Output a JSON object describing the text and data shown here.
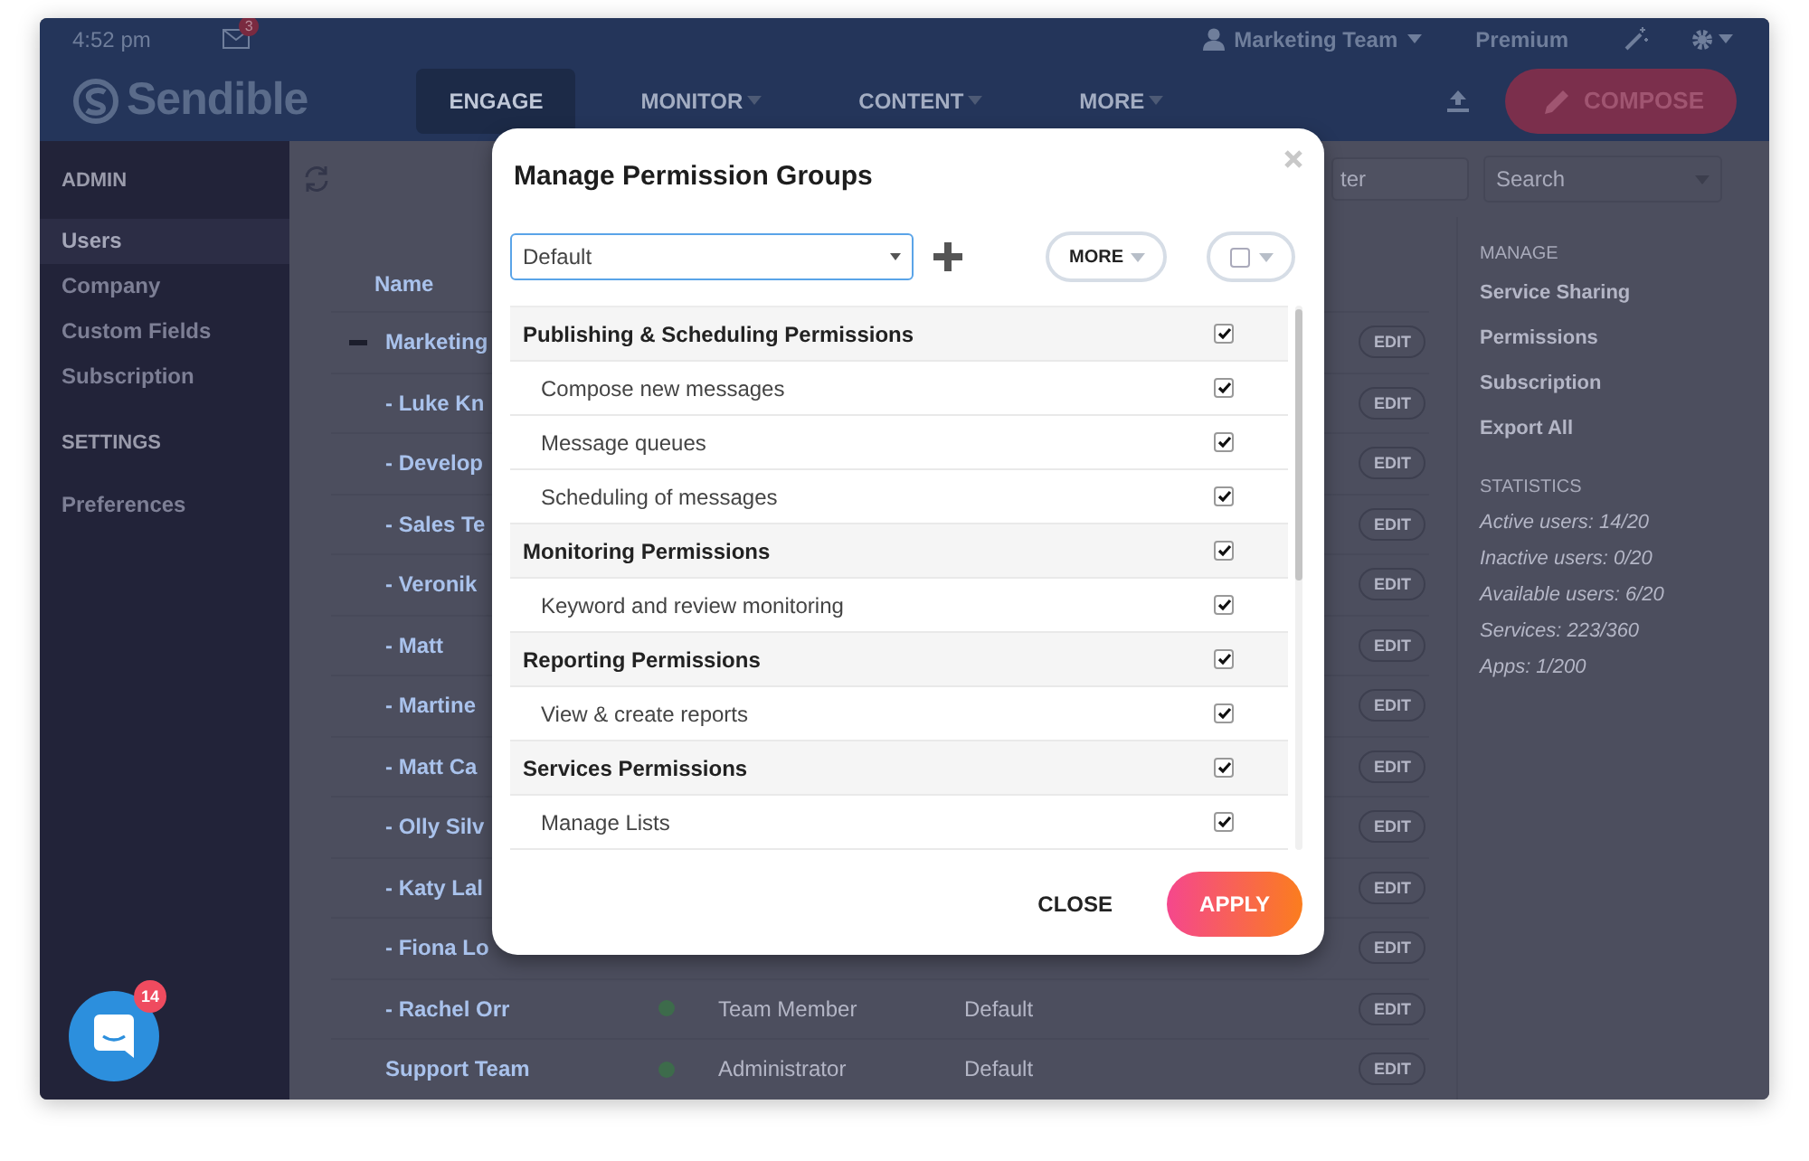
{
  "top_bar": {
    "time": "4:52 pm",
    "mail_badge": "3",
    "account": "Marketing Team",
    "plan": "Premium"
  },
  "nav_bar": {
    "logo": "Sendible",
    "items": [
      {
        "label": "ENGAGE",
        "selected": true,
        "dropdown": false
      },
      {
        "label": "MONITOR",
        "selected": false,
        "dropdown": true
      },
      {
        "label": "CONTENT",
        "selected": false,
        "dropdown": true
      },
      {
        "label": "MORE",
        "selected": false,
        "dropdown": true
      }
    ],
    "compose_button": "COMPOSE"
  },
  "sidebar": {
    "sections": [
      {
        "heading": "ADMIN",
        "items": [
          {
            "label": "Users",
            "selected": true
          },
          {
            "label": "Company",
            "selected": false
          },
          {
            "label": "Custom Fields",
            "selected": false
          },
          {
            "label": "Subscription",
            "selected": false
          }
        ]
      },
      {
        "heading": "SETTINGS",
        "items": [
          {
            "label": "Preferences",
            "selected": false
          }
        ]
      }
    ]
  },
  "toolbar": {
    "filter": {
      "placeholder": "ter"
    },
    "search": {
      "placeholder": "Search"
    }
  },
  "table": {
    "columns": [
      "Name"
    ],
    "rows": [
      {
        "name": "Marketing",
        "expanded": true,
        "action": "EDIT"
      },
      {
        "name": "- Luke Kn",
        "action": "EDIT"
      },
      {
        "name": "- Develop",
        "action": "EDIT"
      },
      {
        "name": "- Sales Te",
        "action": "EDIT"
      },
      {
        "name": "- Veronik",
        "action": "EDIT"
      },
      {
        "name": "- Matt",
        "action": "EDIT"
      },
      {
        "name": "- Martine",
        "action": "EDIT"
      },
      {
        "name": "- Matt Ca",
        "action": "EDIT"
      },
      {
        "name": "- Olly Silv",
        "action": "EDIT"
      },
      {
        "name": "- Katy Lal",
        "action": "EDIT"
      },
      {
        "name": "- Fiona Lo",
        "action": "EDIT"
      },
      {
        "name": "- Rachel Orr",
        "color": "#3d6b4b",
        "role": "Team Member",
        "group": "Default",
        "action": "EDIT"
      },
      {
        "name": "Support Team",
        "color": "#3d6b4b",
        "role": "Administrator",
        "group": "Default",
        "action": "EDIT"
      }
    ]
  },
  "manage_panel": {
    "heading": "MANAGE",
    "links": [
      "Service Sharing",
      "Permissions",
      "Subscription",
      "Export All"
    ],
    "statistics_heading": "STATISTICS",
    "statistics": [
      "Active users: 14/20",
      "Inactive users: 0/20",
      "Available users: 6/20",
      "Services: 223/360",
      "Apps: 1/200"
    ]
  },
  "modal": {
    "title": "Manage Permission Groups",
    "group_select": {
      "value": "Default"
    },
    "more_button": "MORE",
    "select_all": {
      "checked": false
    },
    "permissions": [
      {
        "label": "Publishing & Scheduling Permissions",
        "kind": "group",
        "checked": true
      },
      {
        "label": "Compose new messages",
        "kind": "permission",
        "checked": true
      },
      {
        "label": "Message queues",
        "kind": "permission",
        "checked": true
      },
      {
        "label": "Scheduling of messages",
        "kind": "permission",
        "checked": true
      },
      {
        "label": "Monitoring Permissions",
        "kind": "group",
        "checked": true
      },
      {
        "label": "Keyword and review monitoring",
        "kind": "permission",
        "checked": true
      },
      {
        "label": "Reporting Permissions",
        "kind": "group",
        "checked": true
      },
      {
        "label": "View & create reports",
        "kind": "permission",
        "checked": true
      },
      {
        "label": "Services Permissions",
        "kind": "group",
        "checked": true
      },
      {
        "label": "Manage Lists",
        "kind": "permission",
        "checked": true
      }
    ],
    "buttons": {
      "close": "CLOSE",
      "apply": "APPLY"
    }
  },
  "chat": {
    "badge": "14"
  }
}
